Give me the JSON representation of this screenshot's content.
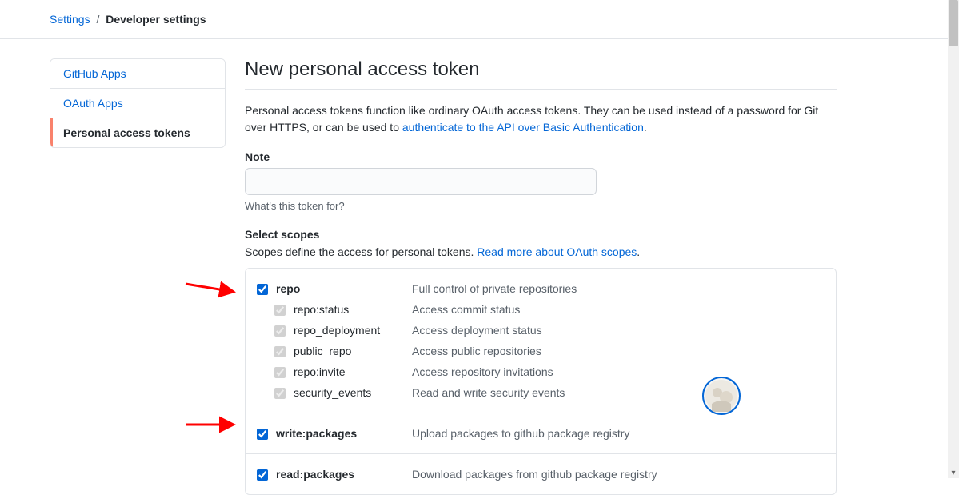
{
  "breadcrumb": {
    "root": "Settings",
    "current": "Developer settings"
  },
  "sidebar": {
    "items": [
      {
        "label": "GitHub Apps",
        "active": false
      },
      {
        "label": "OAuth Apps",
        "active": false
      },
      {
        "label": "Personal access tokens",
        "active": true
      }
    ]
  },
  "main": {
    "title": "New personal access token",
    "description_pre": "Personal access tokens function like ordinary OAuth access tokens. They can be used instead of a password for Git over HTTPS, or can be used to ",
    "description_link": "authenticate to the API over Basic Authentication",
    "description_post": ".",
    "note_label": "Note",
    "note_value": "",
    "note_hint": "What's this token for?",
    "scopes_label": "Select scopes",
    "scopes_desc_pre": "Scopes define the access for personal tokens. ",
    "scopes_desc_link": "Read more about OAuth scopes",
    "scopes_desc_post": "."
  },
  "scopes": [
    {
      "name": "repo",
      "desc": "Full control of private repositories",
      "checked": true,
      "children": [
        {
          "name": "repo:status",
          "desc": "Access commit status",
          "checked": true,
          "disabled": true
        },
        {
          "name": "repo_deployment",
          "desc": "Access deployment status",
          "checked": true,
          "disabled": true
        },
        {
          "name": "public_repo",
          "desc": "Access public repositories",
          "checked": true,
          "disabled": true
        },
        {
          "name": "repo:invite",
          "desc": "Access repository invitations",
          "checked": true,
          "disabled": true
        },
        {
          "name": "security_events",
          "desc": "Read and write security events",
          "checked": true,
          "disabled": true
        }
      ]
    },
    {
      "name": "write:packages",
      "desc": "Upload packages to github package registry",
      "checked": true,
      "children": []
    },
    {
      "name": "read:packages",
      "desc": "Download packages from github package registry",
      "checked": true,
      "children": []
    }
  ]
}
